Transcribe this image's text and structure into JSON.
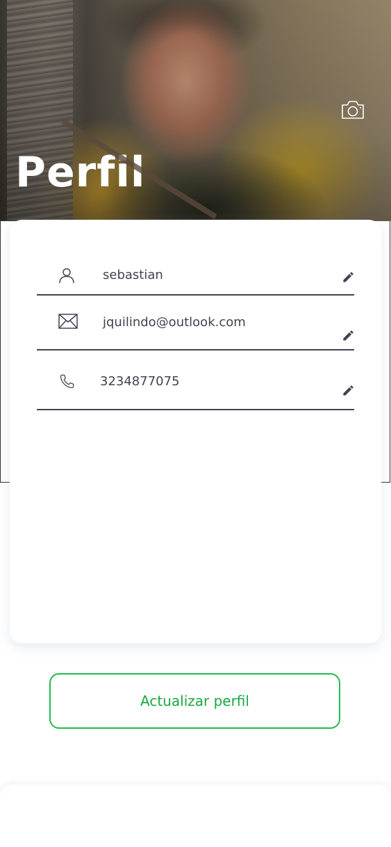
{
  "header": {
    "title": "Perfil",
    "camera_icon": "camera-icon"
  },
  "profile": {
    "name": "sebastian",
    "email": "jquilindo@outlook.com",
    "phone": "3234877075"
  },
  "icons": {
    "user": "user-icon",
    "email": "envelope-icon",
    "phone": "phone-icon",
    "edit": "pencil-icon"
  },
  "actions": {
    "update_label": "Actualizar perfil"
  },
  "colors": {
    "accent_green": "#1fbd4a",
    "text_dark": "#3f4450"
  }
}
